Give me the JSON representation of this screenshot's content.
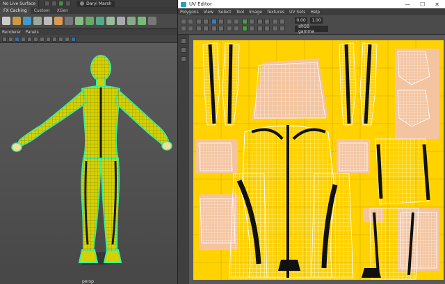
{
  "maya": {
    "live_surface": "No Live Surface",
    "user_name": "Daryl Marsh",
    "shelf_tabs": [
      "FX Caching",
      "Custom",
      "XGen"
    ],
    "panel_menu": [
      "Renderer",
      "Panels"
    ],
    "camera_label": "persp"
  },
  "uv_editor": {
    "title": "UV Editor",
    "menu": [
      "Polygons",
      "View",
      "Select",
      "Tool",
      "Image",
      "Textures",
      "UV Sets",
      "Help"
    ],
    "exposure": "0.00",
    "gamma": "1.00",
    "color_space": "sRGB gamma",
    "window_controls": [
      "—",
      "☐",
      "✕"
    ]
  },
  "colors": {
    "uv_grid_yellow": "#ffd200",
    "uv_shell_skin": "#f4c4a0",
    "wireframe_green": "#40f090",
    "model_yellow": "#d7d000"
  }
}
